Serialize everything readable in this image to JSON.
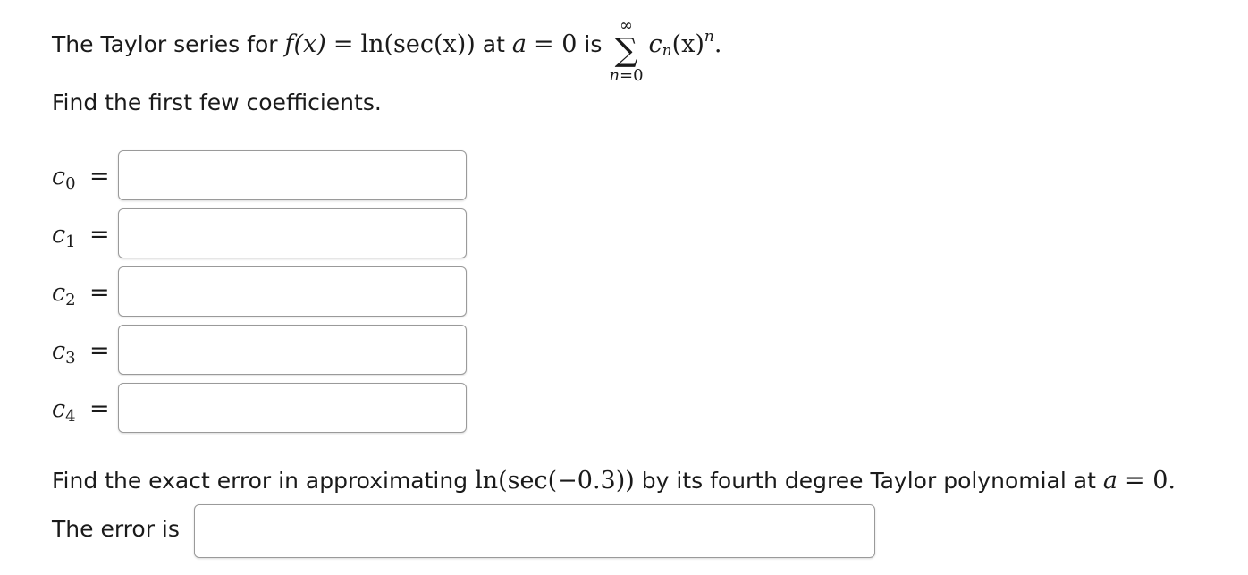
{
  "question": {
    "intro_text": "The Taylor series for",
    "function_lhs": "f(x)",
    "equals": "=",
    "function_rhs": "ln(sec(x))",
    "at_text": "at",
    "center_var": "a",
    "center_eq": "= 0",
    "is_text": "is",
    "sum_upper": "∞",
    "sum_symbol": "∑",
    "sum_lower_var": "n",
    "sum_lower_val": "=0",
    "term_coef": "c",
    "term_coef_sub": "n",
    "term_base": "(x)",
    "term_exp": "n",
    "term_end": ".",
    "find_text": "Find the first few coefficients."
  },
  "coefficients": [
    {
      "symbol": "c",
      "index": "0",
      "equals": "=",
      "value": ""
    },
    {
      "symbol": "c",
      "index": "1",
      "equals": "=",
      "value": ""
    },
    {
      "symbol": "c",
      "index": "2",
      "equals": "=",
      "value": ""
    },
    {
      "symbol": "c",
      "index": "3",
      "equals": "=",
      "value": ""
    },
    {
      "symbol": "c",
      "index": "4",
      "equals": "=",
      "value": ""
    }
  ],
  "error_question": {
    "prefix_text": "Find the exact error in approximating",
    "expression": "ln(sec(−0.3))",
    "suffix_text": "by its fourth degree Taylor polynomial at",
    "center_var": "a",
    "center_eq": "= 0.",
    "answer_label": "The error is",
    "answer_value": ""
  }
}
